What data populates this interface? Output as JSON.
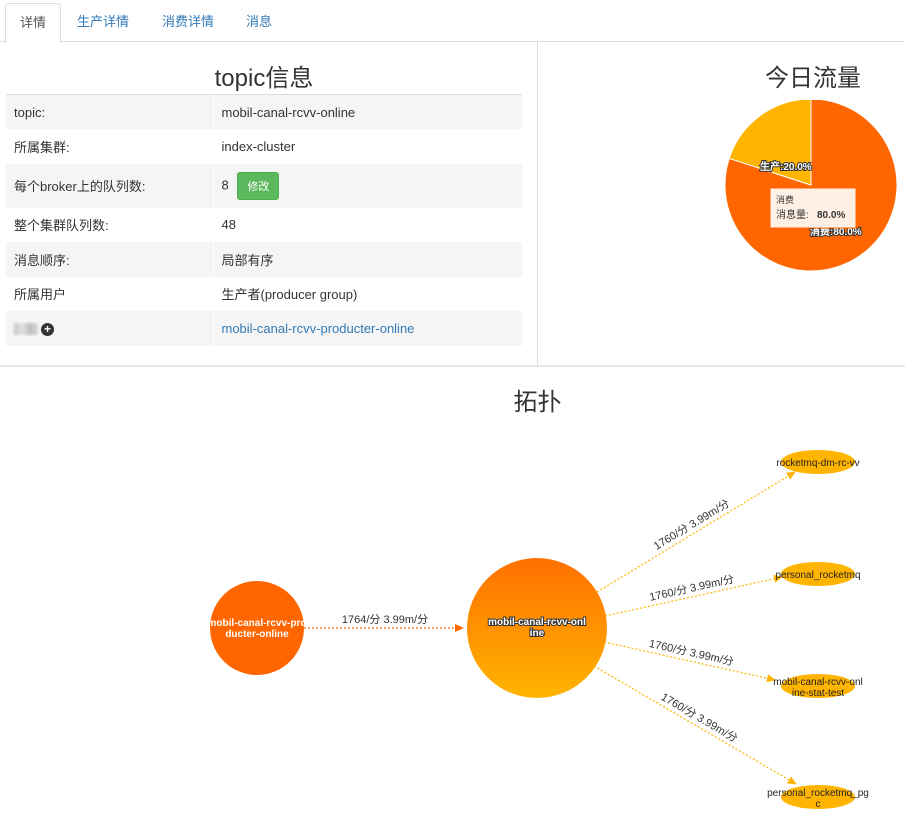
{
  "tabs": [
    "详情",
    "生产详情",
    "消费详情",
    "消息"
  ],
  "topic_info": {
    "title": "topic信息",
    "rows": [
      {
        "key": "topic:",
        "value": "mobil-canal-rcvv-online"
      },
      {
        "key": "所属集群:",
        "value": "index-cluster"
      },
      {
        "key": "每个broker上的队列数:",
        "value": "8",
        "button": "修改"
      },
      {
        "key": "整个集群队列数:",
        "value": "48"
      },
      {
        "key": "消息顺序:",
        "value": "局部有序"
      },
      {
        "key": "所属用户",
        "value": "生产者(producer group)"
      },
      {
        "key": "",
        "value": "mobil-canal-rcvv-producter-online"
      }
    ]
  },
  "traffic": {
    "title": "今日流量",
    "tooltip_title": "消费",
    "tooltip_label": "消息量:",
    "tooltip_value": "80.0%"
  },
  "chart_data": {
    "type": "pie",
    "title": "今日流量",
    "slices": [
      {
        "label": "消费",
        "value": 80.0,
        "color": "#ff6600",
        "text": "消费:80.0%"
      },
      {
        "label": "生产",
        "value": 20.0,
        "color": "#ffb400",
        "text": "生产:20.0%"
      }
    ]
  },
  "topology": {
    "title": "拓扑",
    "producer": {
      "label": [
        "mobil-canal-rcvv-pro",
        "ducter-online"
      ],
      "color": "#ff6600"
    },
    "topic": {
      "label": [
        "mobil-canal-rcvv-onl",
        "ine"
      ],
      "color_top": "#ff7000",
      "color_bottom": "#ffb400"
    },
    "in_edge_label": "1764/分 3.99m/分",
    "consumers": [
      {
        "label": [
          "rocketmq-dm-rc-vv"
        ],
        "edge_label": "1760/分 3.99m/分"
      },
      {
        "label": [
          "personal_rocketmq"
        ],
        "edge_label": "1760/分 3.99m/分"
      },
      {
        "label": [
          "mobil-canal-rcvv-onl",
          "ine-stat-test"
        ],
        "edge_label": "1760/分 3.99m/分"
      },
      {
        "label": [
          "personal_rocketmq_pg",
          "c"
        ],
        "edge_label": "1760/分 3.99m/分"
      }
    ],
    "consumer_color": "#ffb400"
  }
}
